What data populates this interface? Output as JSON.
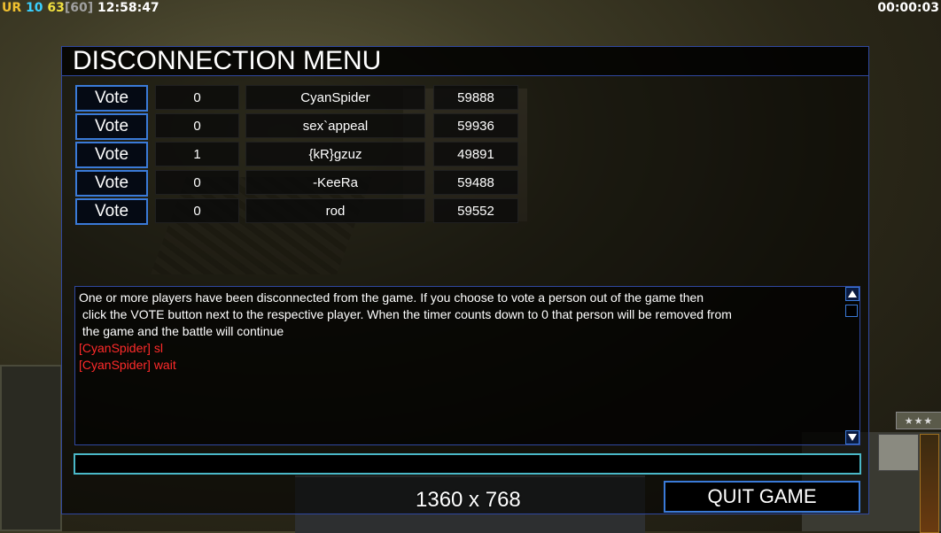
{
  "hud": {
    "faction": "UR",
    "players": "10",
    "fps": "63",
    "fps_cap": "[60]",
    "clock": "12:58:47",
    "elapsed": "00:00:03"
  },
  "dialog": {
    "title": "DISCONNECTION MENU",
    "rows": [
      {
        "vote_label": "Vote",
        "count": "0",
        "name": "CyanSpider",
        "ping": "59888"
      },
      {
        "vote_label": "Vote",
        "count": "0",
        "name": "sex`appeal",
        "ping": "59936"
      },
      {
        "vote_label": "Vote",
        "count": "1",
        "name": "{kR}gzuz",
        "ping": "49891"
      },
      {
        "vote_label": "Vote",
        "count": "0",
        "name": "-KeeRa",
        "ping": "59488"
      },
      {
        "vote_label": "Vote",
        "count": "0",
        "name": "rod",
        "ping": "59552"
      }
    ],
    "chat": {
      "system_message": "One or more players have been disconnected from the game. If you choose to vote a person out of the game then\n click the VOTE button next to the respective player. When the timer counts down to 0 that person will be removed from\n the game and the battle will continue",
      "messages": [
        {
          "text": "[CyanSpider] sl",
          "color": "#ff2a2a"
        },
        {
          "text": "[CyanSpider] wait",
          "color": "#ff2a2a"
        }
      ]
    },
    "chat_input_value": "",
    "quit_label": "QUIT GAME"
  },
  "overlay": {
    "resolution": "1360 x 768"
  },
  "colors": {
    "accent_border": "#3a7ad8",
    "input_border": "#4ab8c8",
    "chat_player_color": "#ff2a2a"
  },
  "icons": [
    "scroll-up-arrow-icon",
    "scroll-down-arrow-icon",
    "rank-stars-icon",
    "unit-portrait-icon",
    "rank-medal-icon"
  ]
}
